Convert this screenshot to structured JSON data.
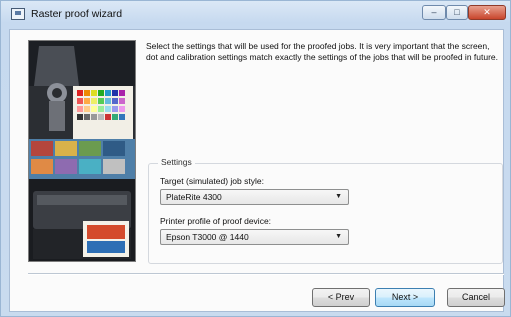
{
  "window": {
    "title": "Raster proof wizard"
  },
  "controls": {
    "minimize": "–",
    "maximize": "□",
    "close": "✕"
  },
  "intro_text": "Select the settings that will be used for the proofed jobs. It is very important that the screen, dot and calibration settings match exactly the settings of the jobs that will be proofed in future.",
  "settings": {
    "legend": "Settings",
    "job_style_label": "Target (simulated) job style:",
    "job_style_value": "PlateRite 4300",
    "profile_label": "Printer profile of proof device:",
    "profile_value": "Epson T3000 @ 1440"
  },
  "buttons": {
    "prev": "< Prev",
    "next": "Next >",
    "cancel": "Cancel"
  },
  "icons": {
    "app": "window-app-icon",
    "dropdown": "chevron-down-icon"
  }
}
